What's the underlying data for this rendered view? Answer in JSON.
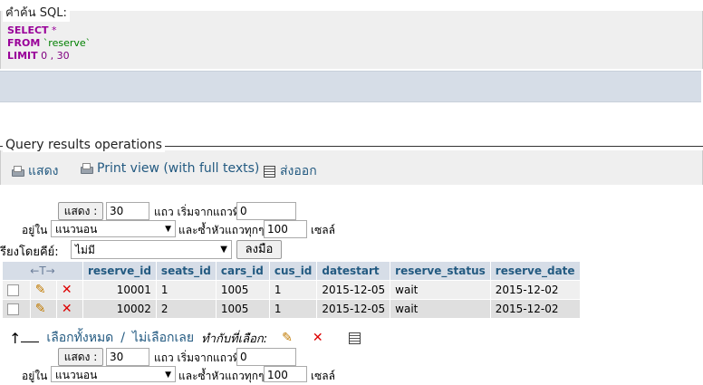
{
  "sql_section": {
    "legend": "คำค้น SQL:",
    "line1_kw": "SELECT",
    "line1_rest": " *",
    "line2_kw": "FROM",
    "line2_str": " `reserve`",
    "line3_kw": "LIMIT",
    "line3_rest": " 0 , 30"
  },
  "ops_section": {
    "legend": "Query results operations",
    "show_label": "แสดง",
    "print_label": "Print view (with full texts)",
    "export_label": "ส่งออก"
  },
  "nav": {
    "show_button": "แสดง :",
    "rows_value": "30",
    "rows_from_label": "แถว เริ่มจากแถวที่",
    "start_value": "0",
    "in_label": "อยู่ใน",
    "mode_value": "แนวนอน",
    "repeat_label": "และซ้ำหัวแถวทุกๆ",
    "repeat_value": "100",
    "cells_label": "เซลล์"
  },
  "sort": {
    "label": "รียงโดยคีย์:",
    "value": "ไม่มี",
    "go_button": "ลงมือ"
  },
  "table": {
    "arrows": "←T→",
    "headers": [
      "reserve_id",
      "seats_id",
      "cars_id",
      "cus_id",
      "datestart",
      "reserve_status",
      "reserve_date"
    ],
    "rows": [
      [
        "10001",
        "1",
        "1005",
        "1",
        "2015-12-05",
        "wait",
        "2015-12-02"
      ],
      [
        "10002",
        "2",
        "1005",
        "1",
        "2015-12-05",
        "wait",
        "2015-12-02"
      ]
    ]
  },
  "bottom": {
    "arrow": "↑",
    "check_all": "เลือกทั้งหมด",
    "separator": "/",
    "uncheck_all": "ไม่เลือกเลย",
    "with_selected": "ทำกับที่เลือก:"
  },
  "colors": {
    "link": "#235a81",
    "header_bg": "#d6dde7",
    "keyword": "#990099"
  }
}
